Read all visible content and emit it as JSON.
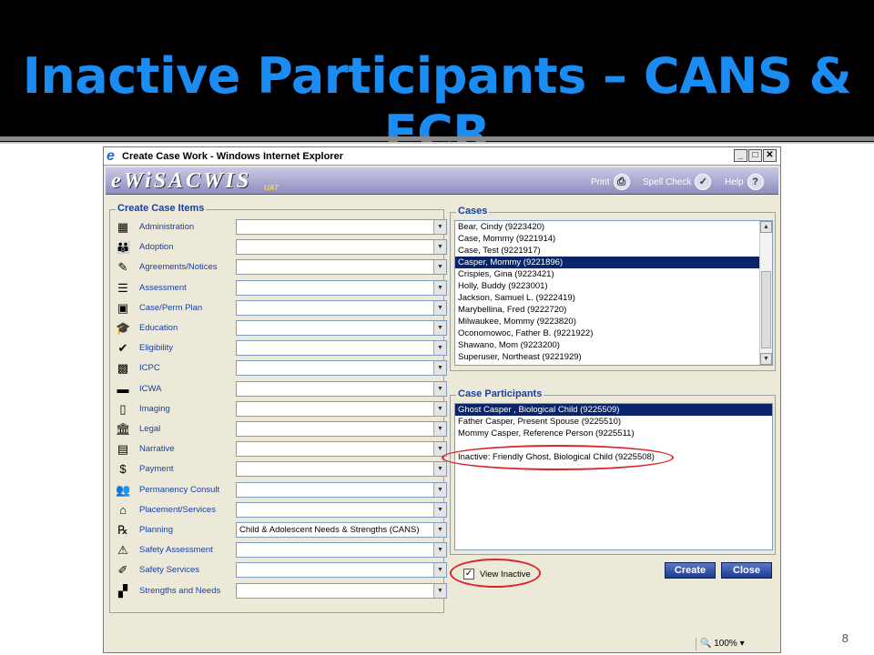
{
  "slide": {
    "title": "Inactive Participants – CANS & FCR",
    "page_number": "8"
  },
  "window": {
    "title": "Create Case Work - Windows Internet Explorer",
    "controls": {
      "minimize": "_",
      "maximize": "□",
      "close": "✕"
    }
  },
  "banner": {
    "logo": "eWiSACWIS",
    "env": "UAT",
    "print": "Print",
    "spell_check": "Spell Check",
    "help": "Help"
  },
  "create_items": {
    "legend": "Create Case Items",
    "rows": [
      {
        "label": "Administration",
        "icon": "administration-icon",
        "glyph": "▦",
        "value": ""
      },
      {
        "label": "Adoption",
        "icon": "adoption-icon",
        "glyph": "👪",
        "value": ""
      },
      {
        "label": "Agreements/Notices",
        "icon": "agreements-icon",
        "glyph": "✎",
        "value": ""
      },
      {
        "label": "Assessment",
        "icon": "assessment-icon",
        "glyph": "☰",
        "value": ""
      },
      {
        "label": "Case/Perm Plan",
        "icon": "case-plan-icon",
        "glyph": "▣",
        "value": ""
      },
      {
        "label": "Education",
        "icon": "education-icon",
        "glyph": "🎓",
        "value": ""
      },
      {
        "label": "Eligibility",
        "icon": "eligibility-icon",
        "glyph": "✔",
        "value": ""
      },
      {
        "label": "ICPC",
        "icon": "icpc-icon",
        "glyph": "▩",
        "value": ""
      },
      {
        "label": "ICWA",
        "icon": "icwa-icon",
        "glyph": "▬",
        "value": ""
      },
      {
        "label": "Imaging",
        "icon": "imaging-icon",
        "glyph": "▯",
        "value": ""
      },
      {
        "label": "Legal",
        "icon": "legal-icon",
        "glyph": "🏛",
        "value": ""
      },
      {
        "label": "Narrative",
        "icon": "narrative-icon",
        "glyph": "▤",
        "value": ""
      },
      {
        "label": "Payment",
        "icon": "payment-icon",
        "glyph": "$",
        "value": ""
      },
      {
        "label": "Permanency Consult",
        "icon": "permanency-icon",
        "glyph": "👥",
        "value": ""
      },
      {
        "label": "Placement/Services",
        "icon": "placement-icon",
        "glyph": "⌂",
        "value": ""
      },
      {
        "label": "Planning",
        "icon": "planning-icon",
        "glyph": "℞",
        "value": "Child & Adolescent Needs & Strengths (CANS)"
      },
      {
        "label": "Safety Assessment",
        "icon": "safety-assessment-icon",
        "glyph": "⚠",
        "value": ""
      },
      {
        "label": "Safety Services",
        "icon": "safety-services-icon",
        "glyph": "✐",
        "value": ""
      },
      {
        "label": "Strengths and Needs",
        "icon": "strengths-icon",
        "glyph": "▞",
        "value": ""
      }
    ]
  },
  "cases": {
    "legend": "Cases",
    "items": [
      "Bear, Cindy (9223420)",
      "Case, Mommy (9221914)",
      "Case, Test (9221917)",
      "Casper, Mommy (9221896)",
      "Crispies, Gina (9223421)",
      "Holly, Buddy (9223001)",
      "Jackson, Samuel L. (9222419)",
      "Marybellina, Fred (9222720)",
      "Milwaukee, Mommy (9223820)",
      "Oconomowoc, Father B. (9221922)",
      "Shawano, Mom (9223200)",
      "Superuser, Northeast (9221929)"
    ],
    "selected_index": 3
  },
  "participants": {
    "legend": "Case Participants",
    "items": [
      "Ghost Casper , Biological Child (9225509)",
      "Father Casper, Present Spouse (9225510)",
      "Mommy Casper, Reference Person (9225511)",
      "",
      "Inactive: Friendly Ghost, Biological Child (9225508)"
    ],
    "selected_index": 0
  },
  "view_inactive": {
    "label": "View Inactive",
    "checked_glyph": "✓"
  },
  "buttons": {
    "create": "Create",
    "close": "Close"
  },
  "status_bar": {
    "zoom": "100%"
  },
  "colors": {
    "title_blue": "#1b8cf2",
    "highlight_red": "#d9262b",
    "selection_navy": "#0a246a"
  }
}
